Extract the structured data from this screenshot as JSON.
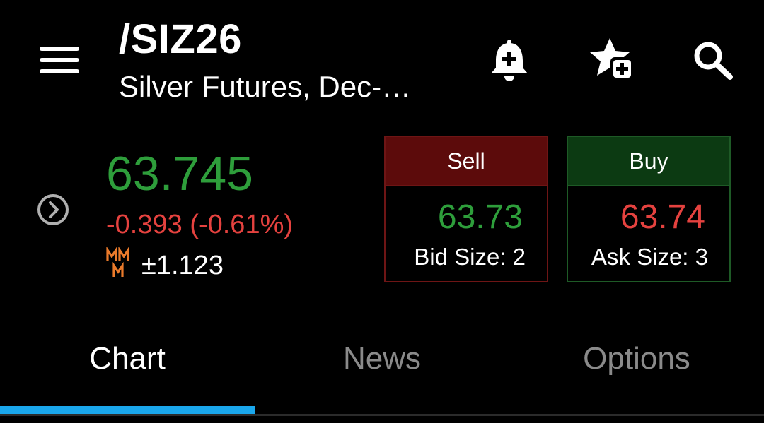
{
  "header": {
    "symbol": "/SIZ26",
    "description": "Silver Futures, Dec-…",
    "icons": [
      "menu-icon",
      "bell-plus-icon",
      "star-plus-icon",
      "search-icon"
    ]
  },
  "quote": {
    "last": "63.745",
    "net_change": "-0.393 (-0.61%)",
    "mm_label": "MM M",
    "mm_value": "±1.123",
    "expand_icon": "chevron-right-circle-icon"
  },
  "bid": {
    "label": "Sell",
    "price": "63.73",
    "size_text": "Bid Size: 2"
  },
  "ask": {
    "label": "Buy",
    "price": "63.74",
    "size_text": "Ask Size: 3"
  },
  "tabs": [
    {
      "label": "Chart",
      "active": true
    },
    {
      "label": "News",
      "active": false
    },
    {
      "label": "Options",
      "active": false
    }
  ],
  "colors": {
    "background": "#000000",
    "up": "#2e9e3b",
    "down": "#e5423f",
    "mm": "#ea7a2b",
    "sell_fill": "#5c0b0b",
    "sell_border": "#6e1515",
    "buy_fill": "#0c3a12",
    "buy_border": "#1e5a26",
    "tab_active_indicator": "#1aa7ec",
    "tab_inactive_text": "#8a8a8a"
  }
}
